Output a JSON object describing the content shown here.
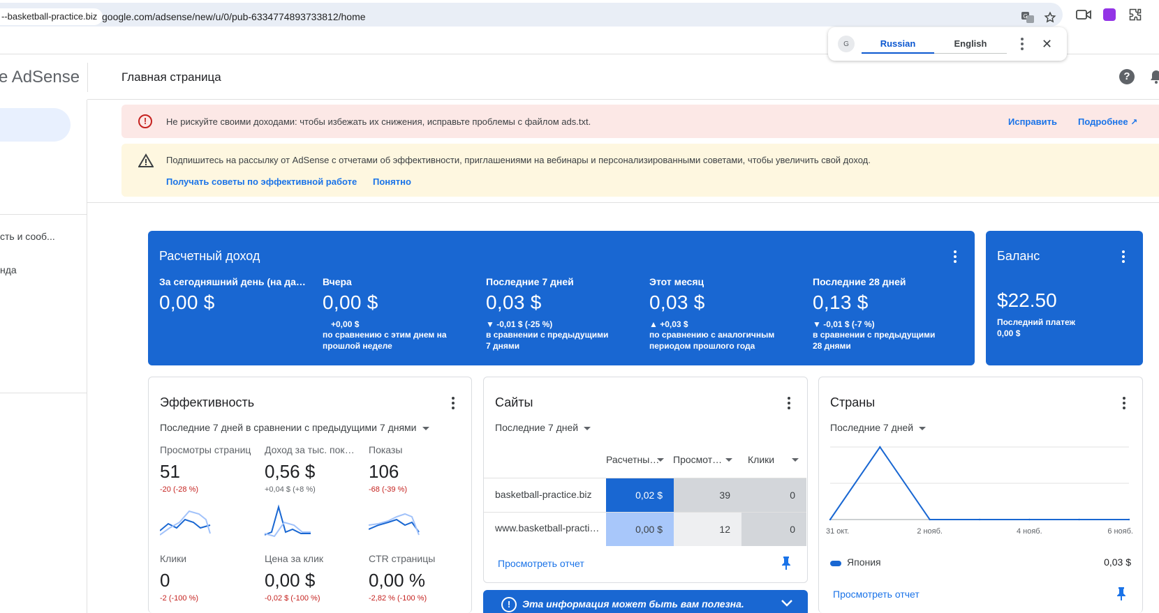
{
  "browser": {
    "site_chip": "--basketball-practice.biz",
    "url": "google.com/adsense/new/u/0/pub-6334774893733812/home"
  },
  "translate": {
    "tab_source": "Russian",
    "tab_target": "English"
  },
  "app": {
    "logo_text": "e AdSense",
    "page_title": "Главная страница"
  },
  "sidebar": {
    "items": [
      {
        "label": "сть и сооб..."
      },
      {
        "label": "нда"
      }
    ]
  },
  "alerts": {
    "error": {
      "text": "Не рискуйте своими доходами: чтобы избежать их снижения, исправьте проблемы с файлом ads.txt.",
      "fix_label": "Исправить",
      "more_label": "Подробнее"
    },
    "newsletter": {
      "text": "Подпишитесь на рассылку от AdSense с отчетами об эффективности, приглашениями на вебинары и персонализированными советами, чтобы увеличить свой доход.",
      "subscribe_label": "Получать советы по эффективной работе",
      "dismiss_label": "Понятно"
    }
  },
  "revenue": {
    "title": "Расчетный доход",
    "columns": [
      {
        "label": "За сегодняшний день (на данный момент)",
        "value": "0,00 $",
        "delta": "",
        "sub1": "",
        "sub2": ""
      },
      {
        "label": "Вчера",
        "value": "0,00 $",
        "delta": "+0,00 $",
        "sub1": "по сравнению с этим днем на",
        "sub2": "прошлой неделе"
      },
      {
        "label": "Последние 7 дней",
        "value": "0,03 $",
        "delta": "▼ -0,01 $ (-25 %)",
        "sub1": "в сравнении с предыдущими",
        "sub2": "7 днями"
      },
      {
        "label": "Этот месяц",
        "value": "0,03 $",
        "delta": "▲ +0,03 $",
        "sub1": "по сравнению с аналогичным",
        "sub2": "периодом прошлого года"
      },
      {
        "label": "Последние 28 дней",
        "value": "0,13 $",
        "delta": "▼ -0,01 $ (-7 %)",
        "sub1": "в сравнении с предыдущими",
        "sub2": "28 днями"
      }
    ]
  },
  "balance": {
    "title": "Баланс",
    "value": "$22.50",
    "last_payment_label": "Последний платеж",
    "last_payment_value": "0,00 $"
  },
  "performance": {
    "title": "Эффективность",
    "period": "Последние 7 дней в сравнении с предыдущими 7 днями",
    "metrics": [
      {
        "label": "Просмотры страниц",
        "value": "51",
        "delta": "-20 (-28 %)",
        "trend": "neg"
      },
      {
        "label": "Доход за тыс. показов",
        "value": "0,56 $",
        "delta": "+0,04 $ (+8 %)",
        "trend": "pos"
      },
      {
        "label": "Показы",
        "value": "106",
        "delta": "-68 (-39 %)",
        "trend": "neg"
      },
      {
        "label": "Клики",
        "value": "0",
        "delta": "-2 (-100 %)",
        "trend": "neg"
      },
      {
        "label": "Цена за клик",
        "value": "0,00 $",
        "delta": "-0,02 $ (-100 %)",
        "trend": "neg"
      },
      {
        "label": "CTR страницы",
        "value": "0,00 %",
        "delta": "-2,82 % (-100 %)",
        "trend": "neg"
      }
    ]
  },
  "sites": {
    "title": "Сайты",
    "period": "Последние 7 дней",
    "columns": [
      "Расчетный доход",
      "Просмотры",
      "Клики"
    ],
    "rows": [
      {
        "site": "basketball-practice.biz",
        "revenue": "0,02 $",
        "views": "39",
        "clicks": "0"
      },
      {
        "site": "www.basketball-practice.biz",
        "revenue": "0,00 $",
        "views": "12",
        "clicks": "0"
      }
    ],
    "report_link": "Просмотреть отчет"
  },
  "countries": {
    "title": "Страны",
    "period": "Последние 7 дней",
    "legend_country": "Япония",
    "legend_value": "0,03 $",
    "report_link": "Просмотреть отчет",
    "chart_data": {
      "type": "line",
      "x": [
        "31 окт.",
        "1 нояб.",
        "2 нояб.",
        "3 нояб.",
        "4 нояб.",
        "5 нояб.",
        "6 нояб."
      ],
      "x_tick_labels": [
        "31 окт.",
        "2 нояб.",
        "4 нояб.",
        "6 нояб."
      ],
      "series": [
        {
          "name": "Япония",
          "values": [
            0,
            0.03,
            0,
            0,
            0,
            0,
            0
          ]
        }
      ],
      "ylim": [
        0,
        0.03
      ],
      "color": "#1967d2"
    }
  },
  "info_bar": {
    "text": "Эта информация может быть вам полезна."
  },
  "colors": {
    "accent": "#1967d2",
    "link": "#1a73e8",
    "negative": "#c5221f",
    "error_bg": "#fce8e6",
    "warning_bg": "#fef7e0"
  }
}
